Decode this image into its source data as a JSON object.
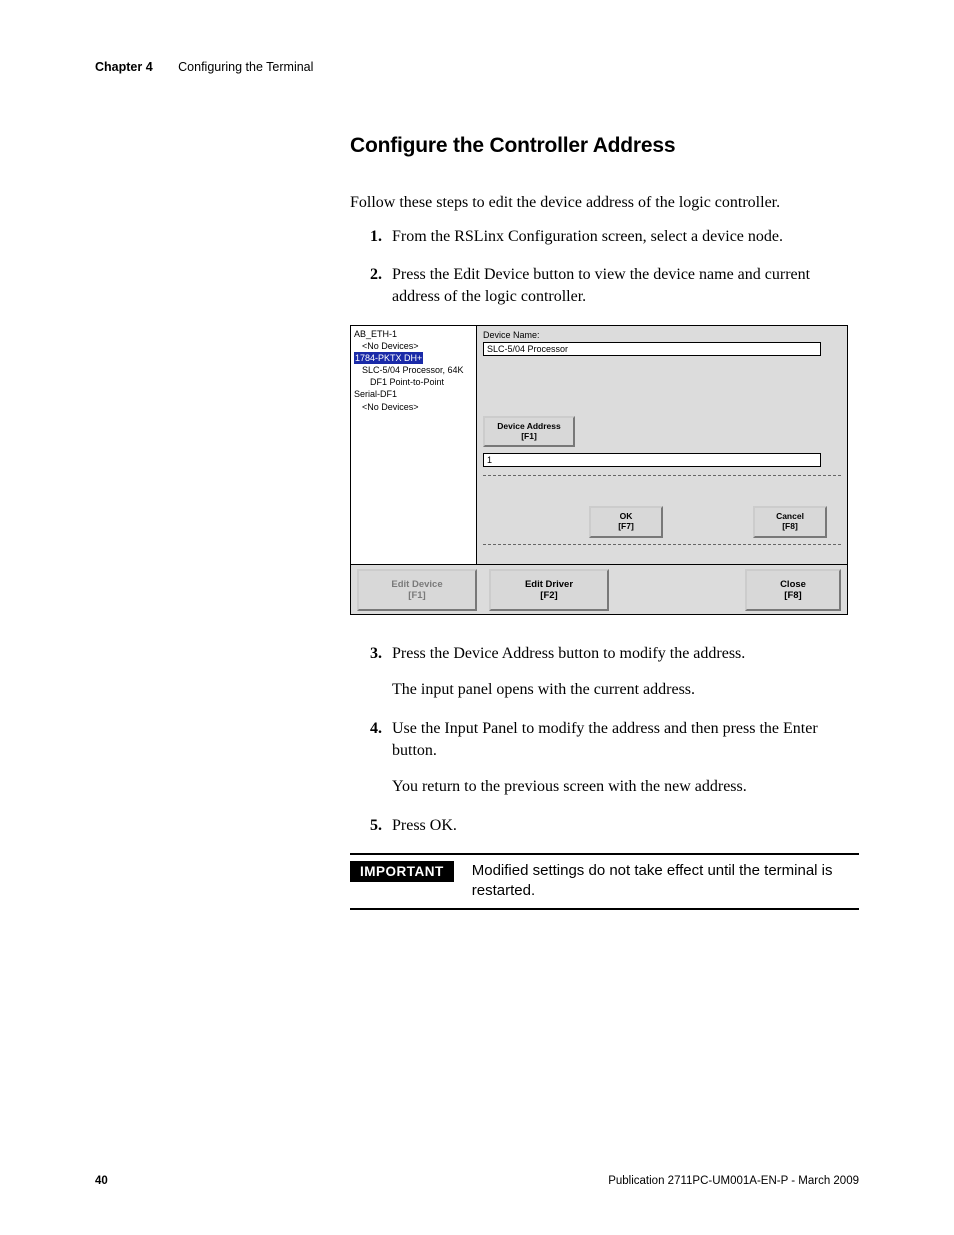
{
  "header": {
    "chapter_label": "Chapter 4",
    "chapter_title": "Configuring the Terminal"
  },
  "section": {
    "title": "Configure the Controller Address",
    "intro": "Follow these steps to edit the device address of the logic controller."
  },
  "steps": {
    "s1": {
      "num": "1.",
      "text": "From the RSLinx Configuration screen, select a device node."
    },
    "s2": {
      "num": "2.",
      "text": "Press the Edit Device button to view the device name and current address of the logic controller."
    },
    "s3": {
      "num": "3.",
      "text": "Press the Device Address button to modify the address.",
      "follow": "The input panel opens with the current address."
    },
    "s4": {
      "num": "4.",
      "text": "Use the Input Panel to modify the address and then press the Enter button.",
      "follow": "You return to the previous screen with the new address."
    },
    "s5": {
      "num": "5.",
      "text": "Press OK."
    }
  },
  "ui": {
    "tree": {
      "n0": "AB_ETH-1",
      "n1": "<No Devices>",
      "n2_sel": "1784-PKTX DH+",
      "n3": "SLC-5/04 Processor, 64K",
      "n4": "DF1 Point-to-Point",
      "n5": "Serial-DF1",
      "n6": "<No Devices>"
    },
    "device_name_label": "Device Name:",
    "device_name_value": "SLC-5/04 Processor",
    "device_address_btn": {
      "label": "Device Address",
      "key": "[F1]"
    },
    "address_value": "1",
    "ok_btn": {
      "label": "OK",
      "key": "[F7]"
    },
    "cancel_btn": {
      "label": "Cancel",
      "key": "[F8]"
    },
    "edit_device_btn": {
      "label": "Edit Device",
      "key": "[F1]"
    },
    "edit_driver_btn": {
      "label": "Edit Driver",
      "key": "[F2]"
    },
    "close_btn": {
      "label": "Close",
      "key": "[F8]"
    }
  },
  "callout": {
    "tag": "IMPORTANT",
    "msg": "Modified settings do not take effect until the terminal is restarted."
  },
  "footer": {
    "page": "40",
    "pub": "Publication 2711PC-UM001A-EN-P - March 2009"
  }
}
